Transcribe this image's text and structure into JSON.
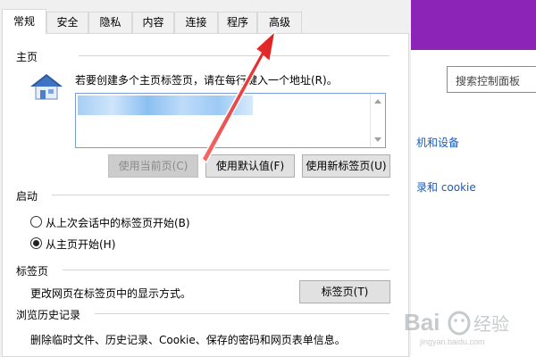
{
  "tabs": [
    {
      "label": "常规",
      "active": true
    },
    {
      "label": "安全"
    },
    {
      "label": "隐私"
    },
    {
      "label": "内容"
    },
    {
      "label": "连接"
    },
    {
      "label": "程序"
    },
    {
      "label": "高级"
    }
  ],
  "home": {
    "title": "主页",
    "instruction": "若要创建多个主页标签页，请在每行键入一个地址(R)。",
    "buttons": {
      "use_current": "使用当前页(C)",
      "use_default": "使用默认值(F)",
      "use_new_tab": "使用新标签页(U)"
    }
  },
  "startup": {
    "title": "启动",
    "options": [
      {
        "label": "从上次会话中的标签页开始(B)",
        "checked": false
      },
      {
        "label": "从主页开始(H)",
        "checked": true
      }
    ]
  },
  "tabs_section": {
    "title": "标签页",
    "description": "更改网页在标签页中的显示方式。",
    "button": "标签页(T)"
  },
  "history": {
    "title": "浏览历史记录",
    "description": "删除临时文件、历史记录、Cookie、保存的密码和网页表单信息。"
  },
  "background": {
    "search_placeholder": "搜索控制面板",
    "link1": "机和设备",
    "link2": "录和 cookie",
    "accent": "#8d24b8"
  },
  "annotation": {
    "arrow_color": "#e53935"
  },
  "watermark": {
    "text": "Bai du 经验"
  }
}
